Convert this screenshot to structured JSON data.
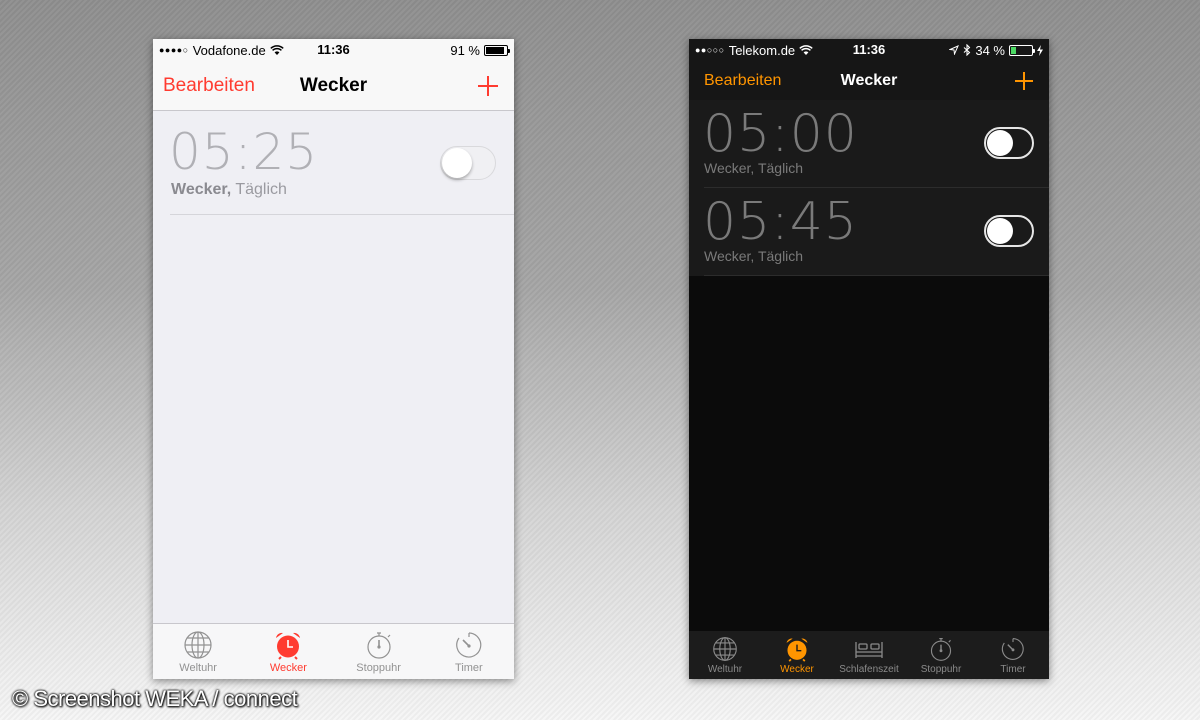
{
  "colors": {
    "light_accent": "#ff3b30",
    "dark_accent": "#ff9500",
    "battery_light": "#000000",
    "battery_dark": "#4cd964"
  },
  "light_phone": {
    "status": {
      "carrier": "Vodafone.de",
      "signal_dots": "●●●●○",
      "time": "11:36",
      "battery": "91 %",
      "battery_level": 0.91
    },
    "nav": {
      "left": "Bearbeiten",
      "title": "Wecker",
      "add_icon": "plus-icon"
    },
    "alarms": [
      {
        "time": "05:25",
        "label": "Wecker,",
        "repeat": "Täglich",
        "enabled": false
      }
    ],
    "tabs": [
      {
        "label": "Weltuhr",
        "icon": "globe-icon",
        "active": false
      },
      {
        "label": "Wecker",
        "icon": "alarm-clock-icon",
        "active": true
      },
      {
        "label": "Stoppuhr",
        "icon": "stopwatch-icon",
        "active": false
      },
      {
        "label": "Timer",
        "icon": "timer-icon",
        "active": false
      }
    ]
  },
  "dark_phone": {
    "status": {
      "carrier": "Telekom.de",
      "signal_dots": "●●○○○",
      "time": "11:36",
      "battery": "34 %",
      "battery_level": 0.34
    },
    "nav": {
      "left": "Bearbeiten",
      "title": "Wecker",
      "add_icon": "plus-icon"
    },
    "alarms": [
      {
        "time": "05:00",
        "label": "Wecker, Täglich",
        "enabled": false
      },
      {
        "time": "05:45",
        "label": "Wecker, Täglich",
        "enabled": false
      }
    ],
    "tabs": [
      {
        "label": "Weltuhr",
        "icon": "globe-icon",
        "active": false
      },
      {
        "label": "Wecker",
        "icon": "alarm-clock-icon",
        "active": true
      },
      {
        "label": "Schlafenszeit",
        "icon": "bed-icon",
        "active": false
      },
      {
        "label": "Stoppuhr",
        "icon": "stopwatch-icon",
        "active": false
      },
      {
        "label": "Timer",
        "icon": "timer-icon",
        "active": false
      }
    ]
  },
  "watermark": "© Screenshot WEKA / connect"
}
